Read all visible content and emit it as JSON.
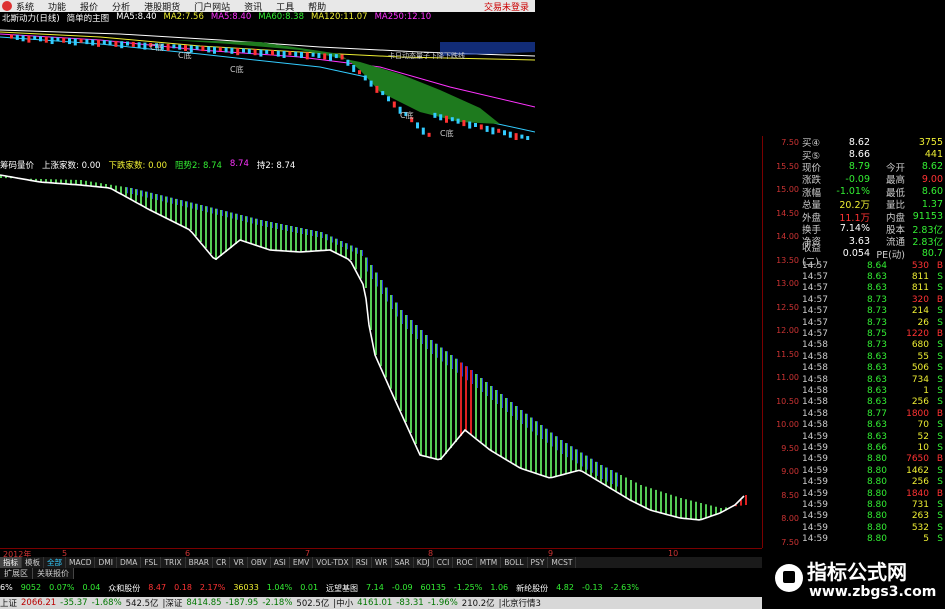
{
  "menu": {
    "items": [
      "系统",
      "功能",
      "报价",
      "分析",
      "港股期货",
      "门户网站",
      "资讯",
      "工具",
      "帮助"
    ],
    "login": "交易未登录"
  },
  "top": {
    "title": "北斯动力(日线)",
    "panel": "简单的主图",
    "ma": [
      {
        "k": "MA5:",
        "v": "8.40"
      },
      {
        "k": "MA2:",
        "v": "7.56"
      },
      {
        "k": "MA5:",
        "v": "8.40"
      },
      {
        "k": "MA60:",
        "v": "8.38"
      },
      {
        "k": "MA120:",
        "v": "11.07"
      },
      {
        "k": "MA250:",
        "v": "12.10"
      }
    ],
    "marker_label": "C底"
  },
  "mid": {
    "title": "筹码量价",
    "up_label": "上涨家数: 0.00",
    "down_label": "下跌家数: 0.00",
    "a": "阻势2: 8.74",
    "b": "8.74",
    "c": "持2: 8.74"
  },
  "axis": [
    "7.50",
    "15.50",
    "15.00",
    "14.50",
    "14.00",
    "13.50",
    "13.00",
    "12.50",
    "12.00",
    "11.50",
    "11.00",
    "10.50",
    "10.00",
    "9.50",
    "9.00",
    "8.50",
    "8.00",
    "7.50"
  ],
  "dates": [
    "2012年",
    "5",
    "6",
    "7",
    "8",
    "9",
    "10"
  ],
  "quote": [
    {
      "l": "买④",
      "v": "8.62",
      "v2": "3755",
      "l2": ""
    },
    {
      "l": "买⑤",
      "v": "8.66",
      "v2": "441",
      "l2": ""
    },
    {
      "l": "现价",
      "v": "8.79",
      "l2": "今开",
      "v2": "8.62"
    },
    {
      "l": "涨跌",
      "v": "-0.09",
      "l2": "最高",
      "v2": "9.00"
    },
    {
      "l": "涨幅",
      "v": "-1.01%",
      "l2": "最低",
      "v2": "8.60"
    },
    {
      "l": "总量",
      "v": "20.2万",
      "l2": "量比",
      "v2": "1.37"
    },
    {
      "l": "外盘",
      "v": "11.1万",
      "l2": "内盘",
      "v2": "91153"
    },
    {
      "l": "换手",
      "v": "7.14%",
      "l2": "股本",
      "v2": "2.83亿"
    },
    {
      "l": "净资",
      "v": "3.63",
      "l2": "流通",
      "v2": "2.83亿"
    },
    {
      "l": "收益(二)",
      "v": "0.054",
      "l2": "PE(动)",
      "v2": "80.7"
    }
  ],
  "ticks": [
    [
      "14:57",
      "8.64",
      "530",
      "B"
    ],
    [
      "14:57",
      "8.63",
      "811",
      "S"
    ],
    [
      "14:57",
      "8.63",
      "811",
      "S"
    ],
    [
      "14:57",
      "8.73",
      "320",
      "B"
    ],
    [
      "14:57",
      "8.73",
      "214",
      "S"
    ],
    [
      "14:57",
      "8.73",
      "26",
      "S"
    ],
    [
      "14:57",
      "8.75",
      "1220",
      "B"
    ],
    [
      "14:58",
      "8.73",
      "680",
      "S"
    ],
    [
      "14:58",
      "8.63",
      "55",
      "S"
    ],
    [
      "14:58",
      "8.63",
      "506",
      "S"
    ],
    [
      "14:58",
      "8.63",
      "734",
      "S"
    ],
    [
      "14:58",
      "8.63",
      "1",
      "S"
    ],
    [
      "14:58",
      "8.63",
      "256",
      "S"
    ],
    [
      "14:58",
      "8.77",
      "1800",
      "B"
    ],
    [
      "14:58",
      "8.63",
      "70",
      "S"
    ],
    [
      "14:59",
      "8.63",
      "52",
      "S"
    ],
    [
      "14:59",
      "8.66",
      "10",
      "S"
    ],
    [
      "14:59",
      "8.80",
      "7650",
      "B"
    ],
    [
      "14:59",
      "8.80",
      "1462",
      "S"
    ],
    [
      "14:59",
      "8.80",
      "256",
      "S"
    ],
    [
      "14:59",
      "8.80",
      "1840",
      "B"
    ],
    [
      "14:59",
      "8.80",
      "731",
      "S"
    ],
    [
      "14:59",
      "8.80",
      "263",
      "S"
    ],
    [
      "14:59",
      "8.80",
      "532",
      "S"
    ],
    [
      "14:59",
      "8.80",
      "5",
      "S"
    ]
  ],
  "tabs": [
    "指标",
    "模板",
    "全部",
    "MACD",
    "DMI",
    "DMA",
    "FSL",
    "TRIX",
    "BRAR",
    "CR",
    "VR",
    "OBV",
    "ASI",
    "EMV",
    "VOL-TDX",
    "RSI",
    "WR",
    "SAR",
    "KDJ",
    "CCI",
    "ROC",
    "MTM",
    "BOLL",
    "PSY",
    "MCST"
  ],
  "subtabs": [
    "扩展区",
    "关联报价"
  ],
  "ticker1": [
    {
      "t": "6%",
      "c": "w"
    },
    {
      "t": "9052",
      "c": "g"
    },
    {
      "t": "0.07%",
      "c": "g"
    },
    {
      "t": "0.04",
      "c": "g"
    },
    {
      "t": "众和股份",
      "c": "w"
    },
    {
      "t": "8.47",
      "c": "r"
    },
    {
      "t": "0.18",
      "c": "r"
    },
    {
      "t": "2.17%",
      "c": "r"
    },
    {
      "t": "36033",
      "c": "y"
    },
    {
      "t": "1.04%",
      "c": "g"
    },
    {
      "t": "0.01",
      "c": "g"
    },
    {
      "t": "远望基图",
      "c": "w"
    },
    {
      "t": "7.14",
      "c": "g"
    },
    {
      "t": "-0.09",
      "c": "g"
    },
    {
      "t": "60135",
      "c": "g"
    },
    {
      "t": "-1.25%",
      "c": "g"
    },
    {
      "t": "1.06",
      "c": "g"
    },
    {
      "t": "新纶股份",
      "c": "w"
    },
    {
      "t": "4.82",
      "c": "g"
    },
    {
      "t": "-0.13",
      "c": "g"
    },
    {
      "t": "-2.63%",
      "c": "g"
    }
  ],
  "status": [
    {
      "t": "上证",
      "c": ""
    },
    {
      "t": "2066.21",
      "c": "r"
    },
    {
      "t": "-35.37",
      "c": "g"
    },
    {
      "t": "-1.68%",
      "c": "g"
    },
    {
      "t": "542.5亿",
      "c": ""
    },
    {
      "t": "|深证",
      "c": ""
    },
    {
      "t": "8414.85",
      "c": "g"
    },
    {
      "t": "-187.95",
      "c": "g"
    },
    {
      "t": "-2.18%",
      "c": "g"
    },
    {
      "t": "502.5亿",
      "c": ""
    },
    {
      "t": "|中小",
      "c": ""
    },
    {
      "t": "4161.01",
      "c": "g"
    },
    {
      "t": "-83.31",
      "c": "g"
    },
    {
      "t": "-1.96%",
      "c": "g"
    },
    {
      "t": "210.2亿",
      "c": ""
    },
    {
      "t": "|北京行情3",
      "c": ""
    }
  ],
  "watermark": {
    "cn": "指标公式网",
    "url": "www.zbgs3.com"
  },
  "chart_data": {
    "type": "area",
    "ylim": [
      7.5,
      15.5
    ]
  }
}
